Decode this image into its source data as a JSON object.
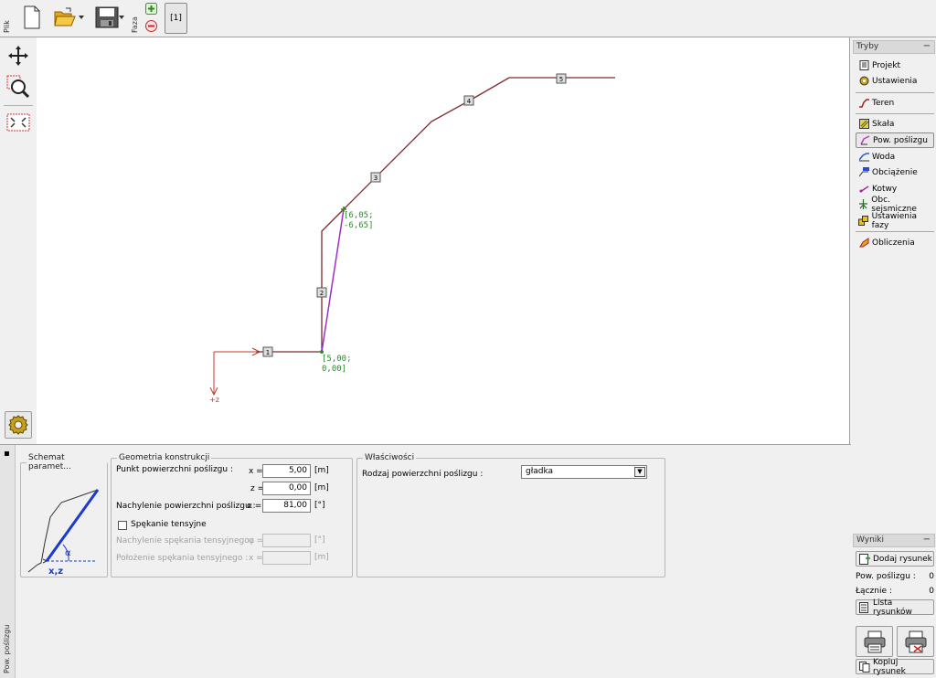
{
  "toolbar": {
    "file_label": "Plik",
    "phase_label": "Faza",
    "phase_value": "[1]"
  },
  "canvas": {
    "points": [
      {
        "label": "[5,00;",
        "label2": "0,00]"
      },
      {
        "label": "[6,05;",
        "label2": "-6,65]"
      }
    ],
    "segment_numbers": [
      "1",
      "2",
      "3",
      "4",
      "5"
    ],
    "axis_z": "+z"
  },
  "modes": {
    "header": "Tryby",
    "items": [
      {
        "label": "Projekt"
      },
      {
        "label": "Ustawienia"
      },
      {
        "label": "Teren"
      },
      {
        "label": "Skała"
      },
      {
        "label": "Pow. poślizgu"
      },
      {
        "label": "Woda"
      },
      {
        "label": "Obciążenie"
      },
      {
        "label": "Kotwy"
      },
      {
        "label": "Obc. sejsmiczne"
      },
      {
        "label": "Ustawienia fazy"
      },
      {
        "label": "Obliczenia"
      }
    ]
  },
  "results": {
    "header": "Wyniki",
    "add_drawing": "Dodaj rysunek",
    "slip_label": "Pow. poślizgu :",
    "slip_count": "0",
    "total_label": "Łącznie :",
    "total_count": "0",
    "list_drawings": "Lista rysunków",
    "copy_drawing": "Kopiuj rysunek"
  },
  "bottom": {
    "side_label": "Pow. poślizgu",
    "schema_title": "Schemat paramet...",
    "schema_xz": "x,z",
    "schema_alpha": "α",
    "geometry_title": "Geometria konstrukcji",
    "point_label": "Punkt powierzchni poślizgu :",
    "x_label": "x =",
    "x_value": "5,00",
    "x_unit": "[m]",
    "z_label": "z =",
    "z_value": "0,00",
    "z_unit": "[m]",
    "incl_label": "Nachylenie powierzchni poślizgu :",
    "alpha_label": "α =",
    "alpha_value": "81,00",
    "alpha_unit": "[°]",
    "tensile_label": "Spękanie tensyjne",
    "tensile_incl_label": "Nachylenie spękania tensyjnego :",
    "phi_label": "φ =",
    "phi_unit": "[°]",
    "tensile_pos_label": "Położenie spękania tensyjnego :",
    "x2_label": "x =",
    "x2_unit": "[m]",
    "props_title": "Właściwości",
    "type_label": "Rodzaj powierzchni poślizgu :",
    "type_value": "gładka"
  }
}
